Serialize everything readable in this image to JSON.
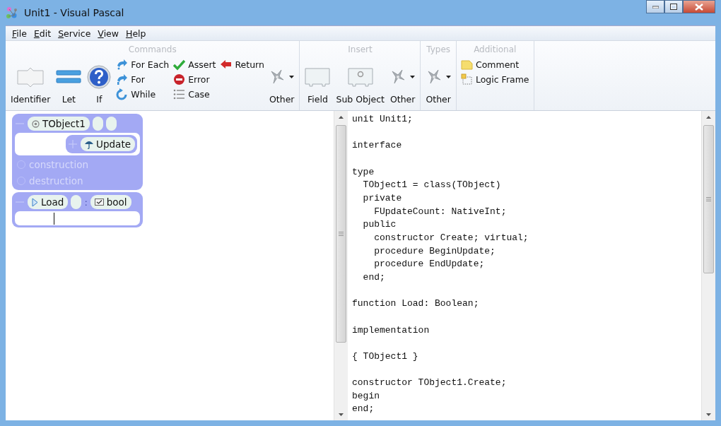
{
  "window": {
    "title": "Unit1 - Visual Pascal"
  },
  "menu": [
    {
      "label": "File"
    },
    {
      "label": "Edit"
    },
    {
      "label": "Service"
    },
    {
      "label": "View"
    },
    {
      "label": "Help"
    }
  ],
  "ribbon": [
    {
      "title": "Commands",
      "items": [
        {
          "kind": "large",
          "label": "Identifier"
        },
        {
          "kind": "large",
          "label": "Let"
        },
        {
          "kind": "large",
          "label": "If"
        },
        {
          "kind": "column",
          "items": [
            {
              "label": "For Each"
            },
            {
              "label": "For"
            },
            {
              "label": "While"
            }
          ]
        },
        {
          "kind": "column",
          "items": [
            {
              "label": "Assert"
            },
            {
              "label": "Error"
            },
            {
              "label": "Case"
            }
          ]
        },
        {
          "kind": "column",
          "items": [
            {
              "label": "Return"
            }
          ]
        },
        {
          "kind": "dropdown",
          "label": "Other"
        }
      ]
    },
    {
      "title": "Insert",
      "items": [
        {
          "kind": "large",
          "label": "Field"
        },
        {
          "kind": "large",
          "label": "Sub Object"
        },
        {
          "kind": "dropdown",
          "label": "Other"
        }
      ]
    },
    {
      "title": "Types",
      "items": [
        {
          "kind": "dropdown",
          "label": "Other"
        }
      ]
    },
    {
      "title": "Additional",
      "items": [
        {
          "kind": "column",
          "items": [
            {
              "label": "Comment"
            },
            {
              "label": "Logic Frame"
            }
          ]
        }
      ]
    }
  ],
  "diagram": [
    {
      "kind": "class",
      "name": "TObject1",
      "expanded": true,
      "methods": [
        {
          "name": "Update",
          "expanded": false
        }
      ],
      "sections": [
        "construction",
        "destruction"
      ]
    },
    {
      "kind": "function",
      "name": "Load",
      "expanded": true,
      "separator": ":",
      "type": "bool"
    }
  ],
  "code": {
    "text": "unit Unit1;\n\ninterface\n\ntype\n  TObject1 = class(TObject)\n  private\n    FUpdateCount: NativeInt;\n  public\n    constructor Create; virtual;\n    procedure BeginUpdate;\n    procedure EndUpdate;\n  end;\n\nfunction Load: Boolean;\n\nimplementation\n\n{ TObject1 }\n\nconstructor TObject1.Create;\nbegin\nend;"
  }
}
